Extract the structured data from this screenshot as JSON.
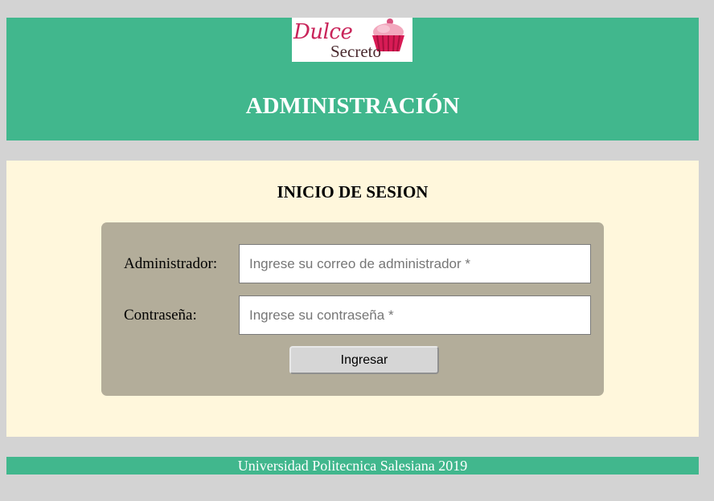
{
  "header": {
    "logo": {
      "script_text": "Dulce",
      "sub_text": "Secreto",
      "icon": "cupcake-icon"
    },
    "title": "ADMINISTRACIÓN"
  },
  "login": {
    "title": "INICIO DE SESION",
    "admin_label": "Administrador:",
    "admin_placeholder": "Ingrese su correo de administrador *",
    "password_label": "Contraseña:",
    "password_placeholder": "Ingrese su contraseña *",
    "submit_label": "Ingresar"
  },
  "footer": {
    "text": "Universidad Politecnica Salesiana 2019"
  },
  "colors": {
    "page_bg": "#d3d3d3",
    "header_bg": "#41b78d",
    "main_bg": "#fff7dc",
    "form_bg": "#b3ad9a",
    "logo_pink": "#c9245a"
  }
}
